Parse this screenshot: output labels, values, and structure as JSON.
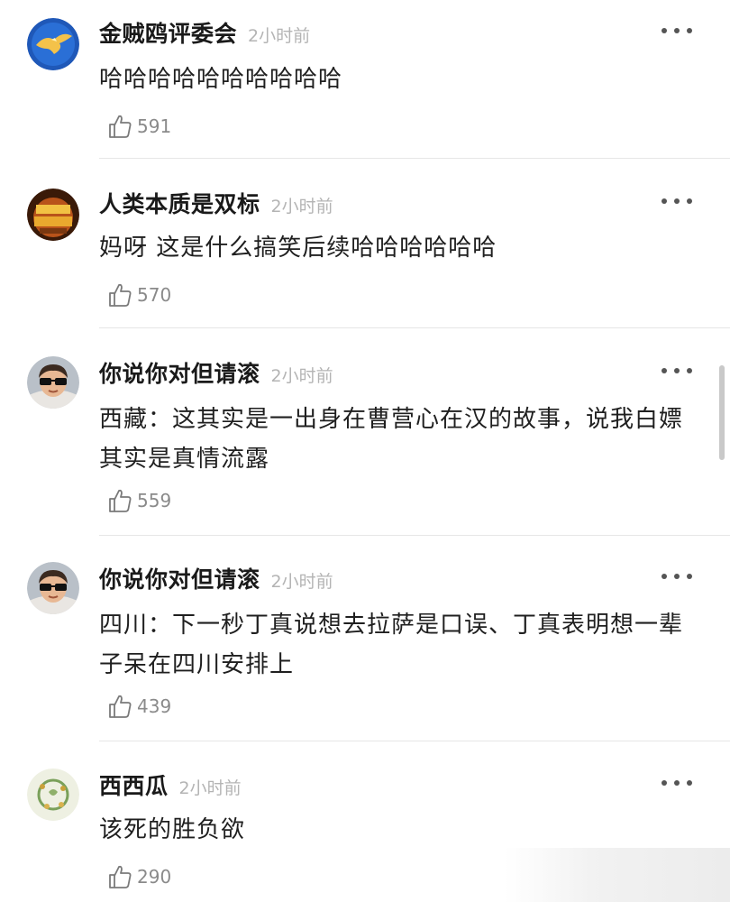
{
  "comments": [
    {
      "username": "金贼鸥评委会",
      "time": "2小时前",
      "text": "哈哈哈哈哈哈哈哈哈哈",
      "likes": "591",
      "avatar": "eagle-emblem-avatar"
    },
    {
      "username": "人类本质是双标",
      "time": "2小时前",
      "text": "妈呀 这是什么搞笑后续哈哈哈哈哈哈",
      "likes": "570",
      "avatar": "golden-text-avatar"
    },
    {
      "username": "你说你对但请滚",
      "time": "2小时前",
      "text": "西藏：这其实是一出身在曹营心在汉的故事，说我白嫖其实是真情流露",
      "likes": "559",
      "avatar": "kid-sunglasses-avatar"
    },
    {
      "username": "你说你对但请滚",
      "time": "2小时前",
      "text": "四川：下一秒丁真说想去拉萨是口误、丁真表明想一辈子呆在四川安排上",
      "likes": "439",
      "avatar": "kid-sunglasses-avatar"
    },
    {
      "username": "西西瓜",
      "time": "2小时前",
      "text": "该死的胜负欲",
      "likes": "290",
      "avatar": "floral-wreath-avatar"
    }
  ],
  "icons": {
    "more": "more-dots-icon",
    "like": "thumbs-up-icon"
  },
  "colors": {
    "username": "#1a1a1a",
    "timestamp": "#b4b4b4",
    "like_count": "#8a8a8a",
    "divider": "#e6e6e6"
  }
}
